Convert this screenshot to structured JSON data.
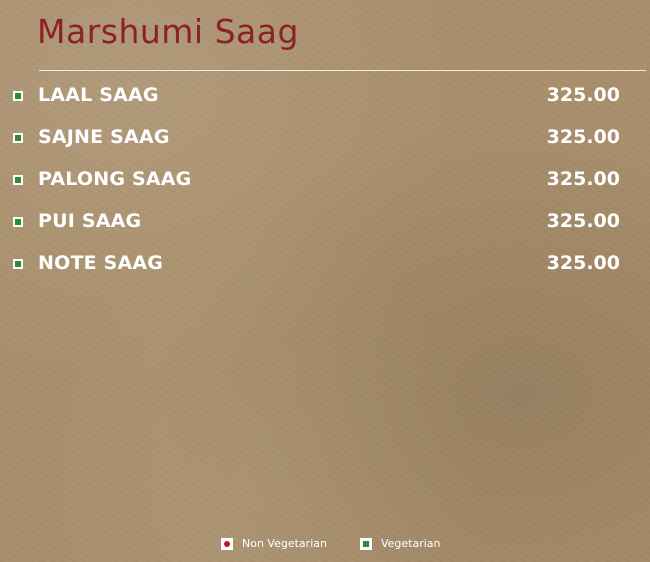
{
  "menu": {
    "title": "Marshumi Saag",
    "items": [
      {
        "name": "LAAL SAAG",
        "price": "325.00",
        "diet": "veg"
      },
      {
        "name": "SAJNE SAAG",
        "price": "325.00",
        "diet": "veg"
      },
      {
        "name": "PALONG SAAG",
        "price": "325.00",
        "diet": "veg"
      },
      {
        "name": "PUI SAAG",
        "price": "325.00",
        "diet": "veg"
      },
      {
        "name": "NOTE SAAG",
        "price": "325.00",
        "diet": "veg"
      }
    ]
  },
  "legend": {
    "non_veg_label": "Non Vegetarian",
    "veg_label": "Vegetarian",
    "non_veg_icon": "non-veg-mark-icon",
    "veg_icon": "veg-mark-icon"
  },
  "colors": {
    "title": "#8b2226",
    "background": "#a98f6c",
    "text": "#ffffff",
    "veg": "#2e8b3a",
    "non_veg": "#c8102e"
  }
}
